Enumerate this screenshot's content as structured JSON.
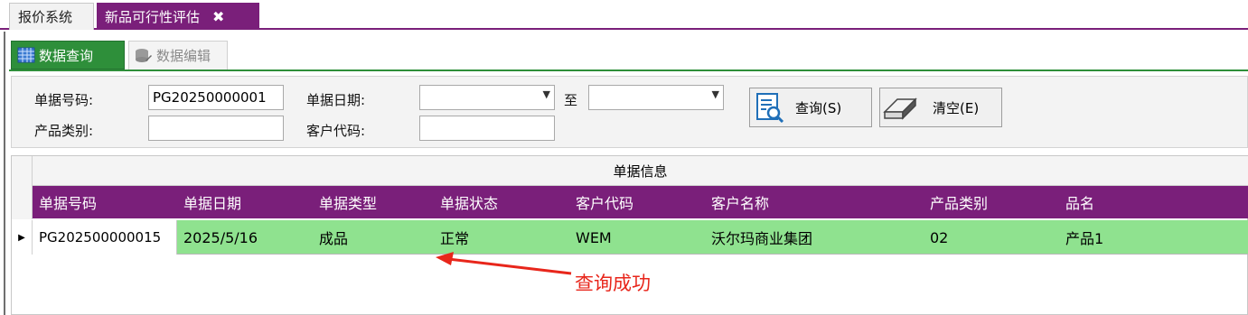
{
  "doc_tabs": [
    {
      "label": "报价系统"
    },
    {
      "label": "新品可行性评估",
      "close": "✖"
    }
  ],
  "sub_tabs": [
    {
      "label": "数据查询"
    },
    {
      "label": "数据编辑"
    }
  ],
  "query": {
    "doc_no_label": "单据号码:",
    "doc_no_value": "PG20250000001",
    "doc_date_label": "单据日期:",
    "date_to_label": "至",
    "product_cat_label": "产品类别:",
    "customer_code_label": "客户代码:",
    "search_button": "查询(S)",
    "clear_button": "清空(E)"
  },
  "grid": {
    "band_title": "单据信息",
    "columns": [
      "单据号码",
      "单据日期",
      "单据类型",
      "单据状态",
      "客户代码",
      "客户名称",
      "产品类别",
      "品名"
    ],
    "rows": [
      [
        "PG202500000015",
        "2025/5/16",
        "成品",
        "正常",
        "WEM",
        "沃尔玛商业集团",
        "02",
        "产品1"
      ]
    ]
  },
  "annotation": {
    "text": "查询成功",
    "color": "#e8261b"
  },
  "colors": {
    "accent_purple": "#7a1f7a",
    "tab_green": "#2e8f3a",
    "row_green": "#8fe28f"
  }
}
